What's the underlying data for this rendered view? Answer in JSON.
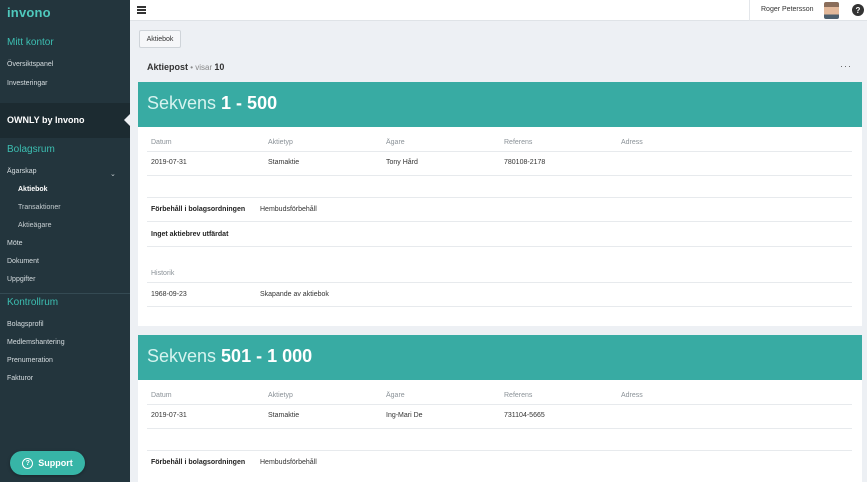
{
  "sidebar": {
    "logo": "invono",
    "section1_title": "Mitt kontor",
    "section1_items": [
      "Översiktspanel",
      "Investeringar"
    ],
    "company": "OWNLY by Invono",
    "section2_title": "Bolagsrum",
    "agarskap": "Ägarskap",
    "agarskap_sub": [
      "Aktiebok",
      "Transaktioner",
      "Aktieägare"
    ],
    "section2_items": [
      "Möte",
      "Dokument",
      "Uppgifter"
    ],
    "section3_title": "Kontrollrum",
    "section3_items": [
      "Bolagsprofil",
      "Medlemshantering",
      "Prenumeration",
      "Fakturor"
    ],
    "support": "Support"
  },
  "topbar": {
    "user_name": "Roger Petersson",
    "help": "?"
  },
  "main": {
    "tab": "Aktiebok",
    "heading_bold": "Aktiepost",
    "heading_mid": " • visar ",
    "heading_count": "10",
    "more": "···",
    "columns": [
      "Datum",
      "Aktietyp",
      "Ägare",
      "Referens",
      "Adress"
    ],
    "cards": [
      {
        "title_prefix": "Sekvens ",
        "title_range": "1 - 500",
        "row": [
          "2019-07-31",
          "Stamaktie",
          "Tony Hård",
          "780108-2178",
          ""
        ],
        "forbehall_label": "Förbehåll i bolagsordningen",
        "forbehall_value": "Hembudsförbehåll",
        "aktiebrev": "Inget aktiebrev utfärdat",
        "historik_label": "Historik",
        "historik_date": "1968-09-23",
        "historik_text": "Skapande av aktiebok"
      },
      {
        "title_prefix": "Sekvens ",
        "title_range": "501 - 1 000",
        "row": [
          "2019-07-31",
          "Stamaktie",
          "Ing-Mari De",
          "731104-5665",
          ""
        ],
        "forbehall_label": "Förbehåll i bolagsordningen",
        "forbehall_value": "Hembudsförbehåll"
      }
    ]
  },
  "colors": {
    "sidebar_bg": "#23353d",
    "accent": "#38aba3",
    "page_bg": "#edf0f4"
  }
}
